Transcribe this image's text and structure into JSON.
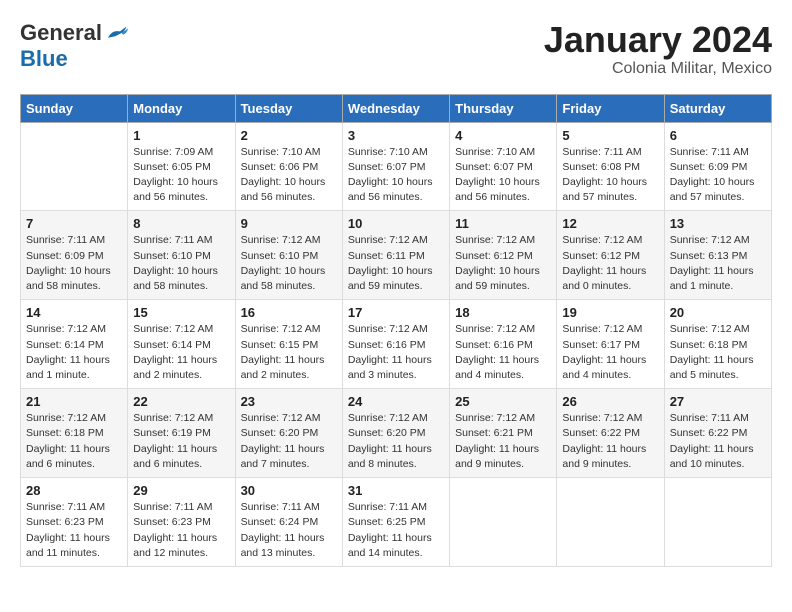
{
  "header": {
    "logo_general": "General",
    "logo_blue": "Blue",
    "month_title": "January 2024",
    "subtitle": "Colonia Militar, Mexico"
  },
  "days_of_week": [
    "Sunday",
    "Monday",
    "Tuesday",
    "Wednesday",
    "Thursday",
    "Friday",
    "Saturday"
  ],
  "weeks": [
    [
      {
        "num": "",
        "info": ""
      },
      {
        "num": "1",
        "info": "Sunrise: 7:09 AM\nSunset: 6:05 PM\nDaylight: 10 hours\nand 56 minutes."
      },
      {
        "num": "2",
        "info": "Sunrise: 7:10 AM\nSunset: 6:06 PM\nDaylight: 10 hours\nand 56 minutes."
      },
      {
        "num": "3",
        "info": "Sunrise: 7:10 AM\nSunset: 6:07 PM\nDaylight: 10 hours\nand 56 minutes."
      },
      {
        "num": "4",
        "info": "Sunrise: 7:10 AM\nSunset: 6:07 PM\nDaylight: 10 hours\nand 56 minutes."
      },
      {
        "num": "5",
        "info": "Sunrise: 7:11 AM\nSunset: 6:08 PM\nDaylight: 10 hours\nand 57 minutes."
      },
      {
        "num": "6",
        "info": "Sunrise: 7:11 AM\nSunset: 6:09 PM\nDaylight: 10 hours\nand 57 minutes."
      }
    ],
    [
      {
        "num": "7",
        "info": "Sunrise: 7:11 AM\nSunset: 6:09 PM\nDaylight: 10 hours\nand 58 minutes."
      },
      {
        "num": "8",
        "info": "Sunrise: 7:11 AM\nSunset: 6:10 PM\nDaylight: 10 hours\nand 58 minutes."
      },
      {
        "num": "9",
        "info": "Sunrise: 7:12 AM\nSunset: 6:10 PM\nDaylight: 10 hours\nand 58 minutes."
      },
      {
        "num": "10",
        "info": "Sunrise: 7:12 AM\nSunset: 6:11 PM\nDaylight: 10 hours\nand 59 minutes."
      },
      {
        "num": "11",
        "info": "Sunrise: 7:12 AM\nSunset: 6:12 PM\nDaylight: 10 hours\nand 59 minutes."
      },
      {
        "num": "12",
        "info": "Sunrise: 7:12 AM\nSunset: 6:12 PM\nDaylight: 11 hours\nand 0 minutes."
      },
      {
        "num": "13",
        "info": "Sunrise: 7:12 AM\nSunset: 6:13 PM\nDaylight: 11 hours\nand 1 minute."
      }
    ],
    [
      {
        "num": "14",
        "info": "Sunrise: 7:12 AM\nSunset: 6:14 PM\nDaylight: 11 hours\nand 1 minute."
      },
      {
        "num": "15",
        "info": "Sunrise: 7:12 AM\nSunset: 6:14 PM\nDaylight: 11 hours\nand 2 minutes."
      },
      {
        "num": "16",
        "info": "Sunrise: 7:12 AM\nSunset: 6:15 PM\nDaylight: 11 hours\nand 2 minutes."
      },
      {
        "num": "17",
        "info": "Sunrise: 7:12 AM\nSunset: 6:16 PM\nDaylight: 11 hours\nand 3 minutes."
      },
      {
        "num": "18",
        "info": "Sunrise: 7:12 AM\nSunset: 6:16 PM\nDaylight: 11 hours\nand 4 minutes."
      },
      {
        "num": "19",
        "info": "Sunrise: 7:12 AM\nSunset: 6:17 PM\nDaylight: 11 hours\nand 4 minutes."
      },
      {
        "num": "20",
        "info": "Sunrise: 7:12 AM\nSunset: 6:18 PM\nDaylight: 11 hours\nand 5 minutes."
      }
    ],
    [
      {
        "num": "21",
        "info": "Sunrise: 7:12 AM\nSunset: 6:18 PM\nDaylight: 11 hours\nand 6 minutes."
      },
      {
        "num": "22",
        "info": "Sunrise: 7:12 AM\nSunset: 6:19 PM\nDaylight: 11 hours\nand 6 minutes."
      },
      {
        "num": "23",
        "info": "Sunrise: 7:12 AM\nSunset: 6:20 PM\nDaylight: 11 hours\nand 7 minutes."
      },
      {
        "num": "24",
        "info": "Sunrise: 7:12 AM\nSunset: 6:20 PM\nDaylight: 11 hours\nand 8 minutes."
      },
      {
        "num": "25",
        "info": "Sunrise: 7:12 AM\nSunset: 6:21 PM\nDaylight: 11 hours\nand 9 minutes."
      },
      {
        "num": "26",
        "info": "Sunrise: 7:12 AM\nSunset: 6:22 PM\nDaylight: 11 hours\nand 9 minutes."
      },
      {
        "num": "27",
        "info": "Sunrise: 7:11 AM\nSunset: 6:22 PM\nDaylight: 11 hours\nand 10 minutes."
      }
    ],
    [
      {
        "num": "28",
        "info": "Sunrise: 7:11 AM\nSunset: 6:23 PM\nDaylight: 11 hours\nand 11 minutes."
      },
      {
        "num": "29",
        "info": "Sunrise: 7:11 AM\nSunset: 6:23 PM\nDaylight: 11 hours\nand 12 minutes."
      },
      {
        "num": "30",
        "info": "Sunrise: 7:11 AM\nSunset: 6:24 PM\nDaylight: 11 hours\nand 13 minutes."
      },
      {
        "num": "31",
        "info": "Sunrise: 7:11 AM\nSunset: 6:25 PM\nDaylight: 11 hours\nand 14 minutes."
      },
      {
        "num": "",
        "info": ""
      },
      {
        "num": "",
        "info": ""
      },
      {
        "num": "",
        "info": ""
      }
    ]
  ]
}
